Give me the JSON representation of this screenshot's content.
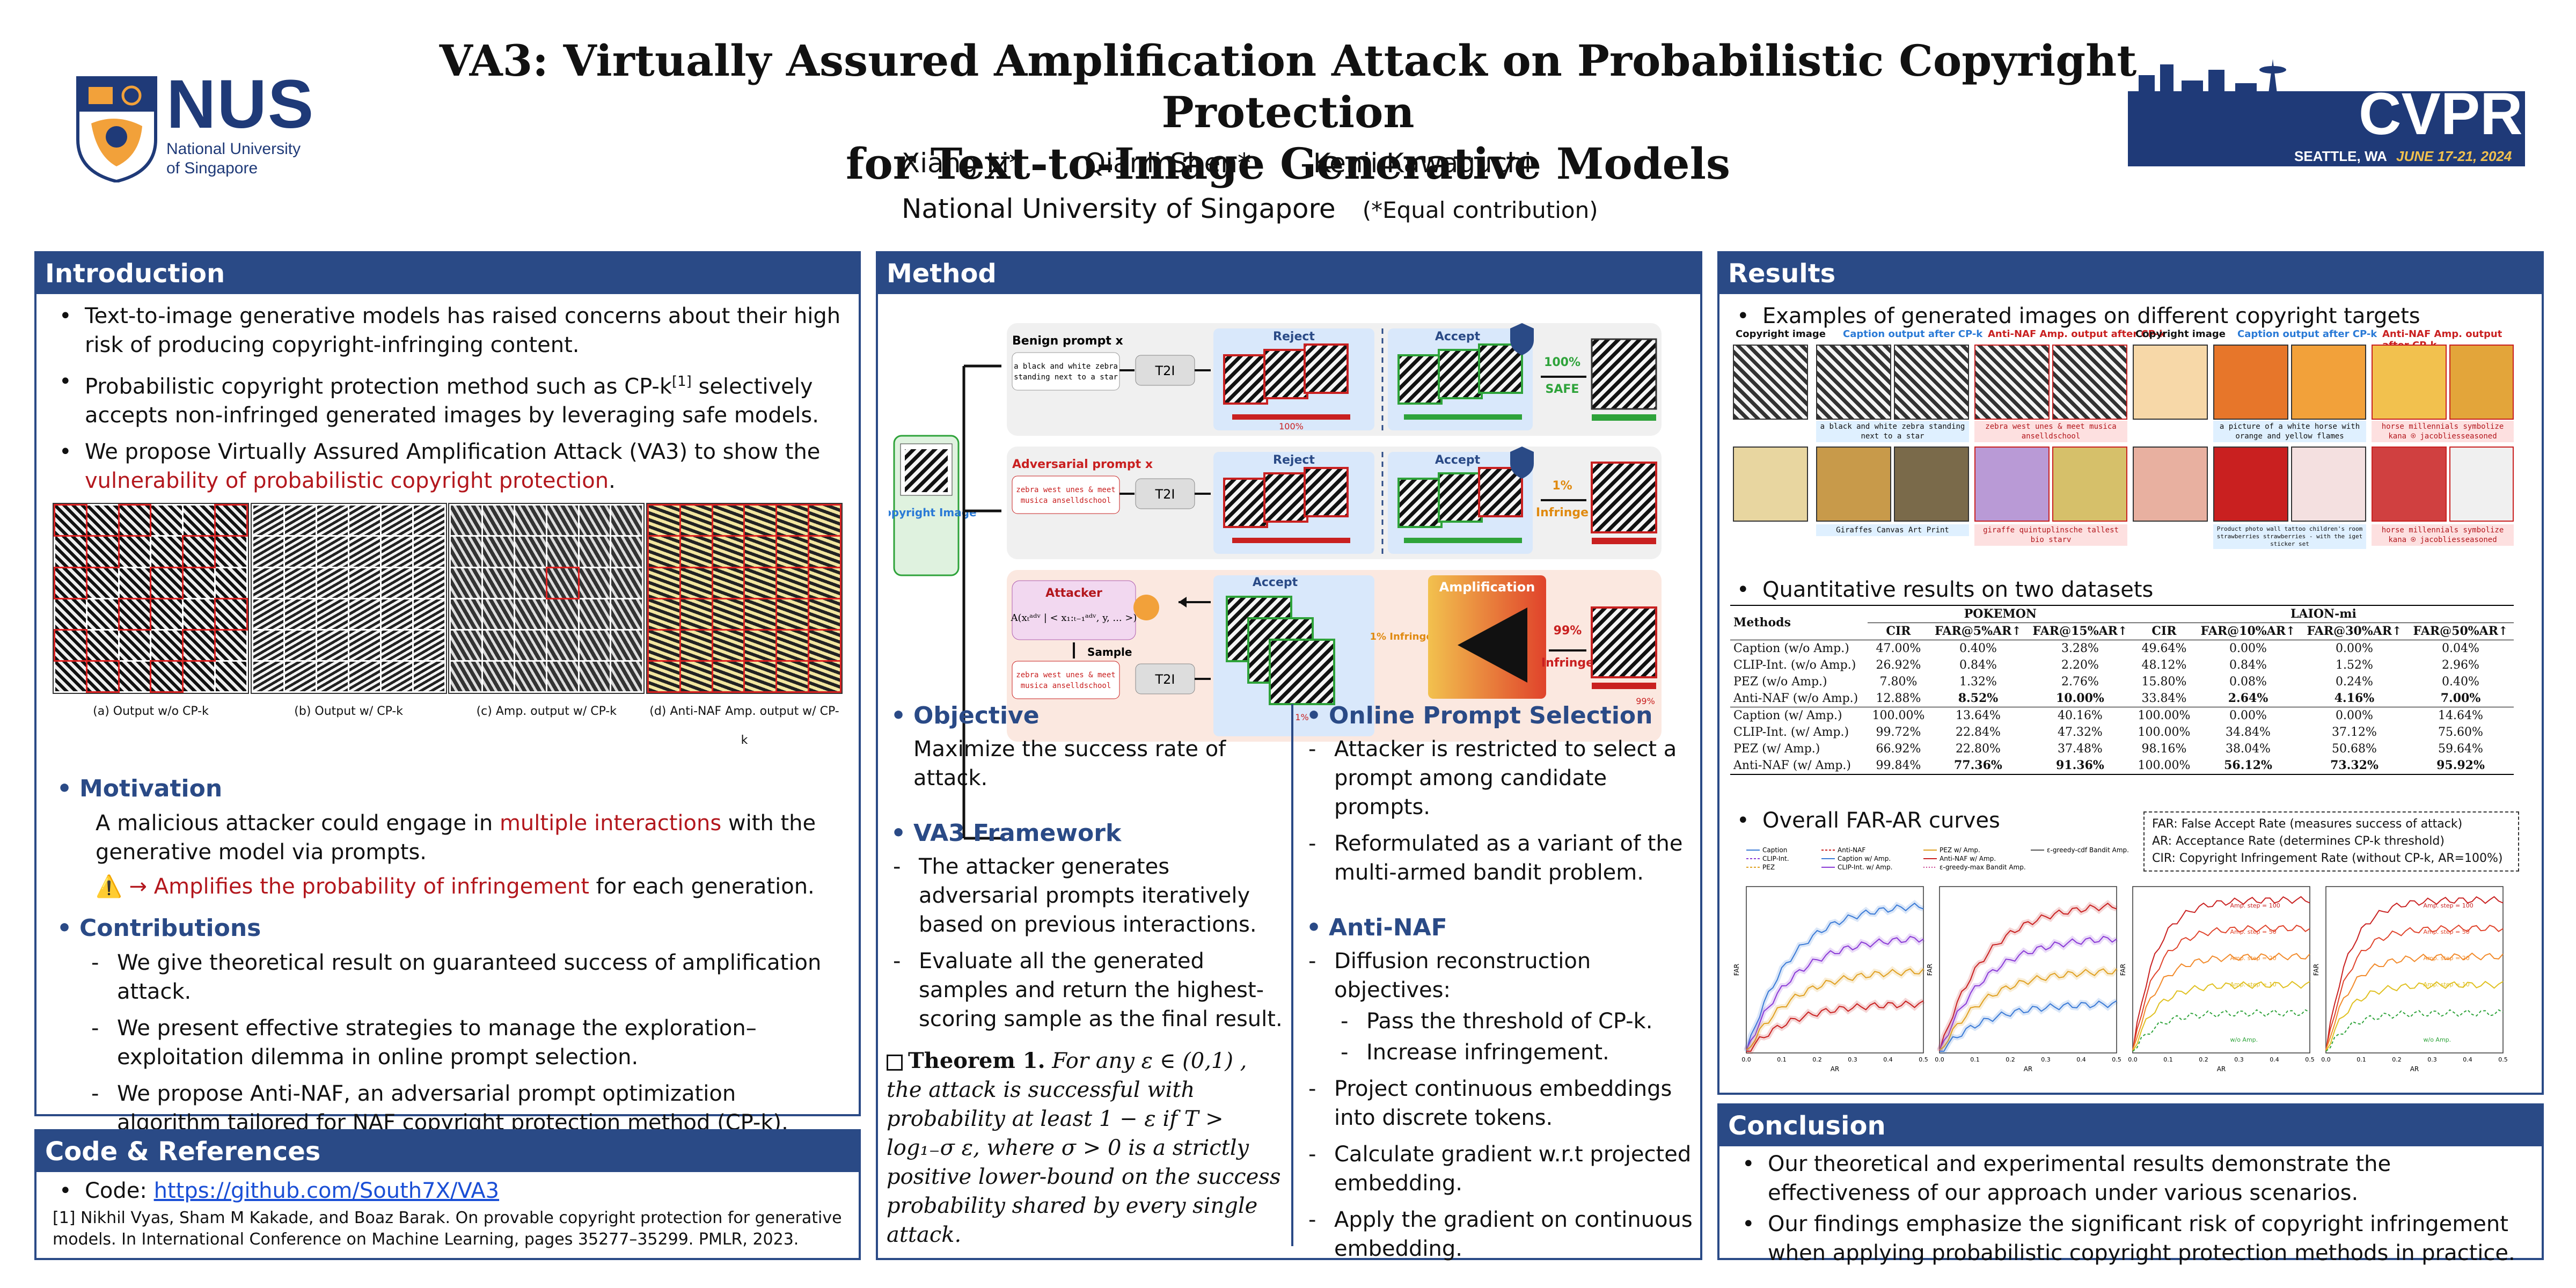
{
  "header": {
    "title_line1": "VA3: Virtually Assured Amplification Attack on Probabilistic Copyright Protection",
    "title_line2": "for Text-to-Image Generative Models",
    "authors": [
      "Xiang Li*",
      "Qianli Shen*",
      "Kenji Kawaguchi"
    ],
    "affiliation": "National University of Singapore",
    "note": "(*Equal contribution)",
    "nus_big": "NUS",
    "nus_line1": "National University",
    "nus_line2": "of Singapore",
    "cvpr_title": "CVPR",
    "cvpr_location": "SEATTLE, WA",
    "cvpr_dates": "JUNE 17-21, 2024"
  },
  "intro": {
    "heading": "Introduction",
    "b1": "Text-to-image generative models has raised concerns about their high risk of producing copyright-infringing content.",
    "b2a": "Probabilistic copyright protection method such as CP-k",
    "b2sup": "[1]",
    "b2b": " selectively accepts non-infringed generated images by leveraging safe models.",
    "b3a": "We propose Virtually Assured Amplification Attack (VA3) to show the ",
    "b3red": "vulnerability of probabilistic copyright protection",
    "b3b": ".",
    "captions": [
      "(a) Output w/o CP-k",
      "(b) Output w/ CP-k",
      "(c) Amp. output w/ CP-k",
      "(d) Anti-NAF Amp. output w/ CP-k"
    ],
    "motivation_title": "Motivation",
    "motivation_a": "A malicious attacker could engage in ",
    "motivation_red": "multiple interactions",
    "motivation_b": " with the generative model via prompts.",
    "warning_icon": "⚠️",
    "warn_red": "→ Amplifies the probability of infringement",
    "warn_b": " for each generation.",
    "contrib_title": "Contributions",
    "contribs": [
      "We give theoretical result on guaranteed success of  amplification attack.",
      "We present effective strategies to manage the exploration–exploitation dilemma in online prompt selection.",
      "We propose Anti-NAF, an adversarial prompt optimization algorithm tailored for NAF copyright protection method (CP-k)."
    ]
  },
  "code": {
    "heading": "Code & References",
    "code_label": "Code: ",
    "code_link": "https://github.com/South7X/VA3",
    "ref": "[1] Nikhil Vyas, Sham M Kakade, and Boaz Barak. On provable copyright protection for generative models. In International Conference on Machine Learning, pages 35277–35299. PMLR, 2023."
  },
  "method": {
    "heading": "Method",
    "diagram": {
      "benign_label": "Benign prompt x",
      "benign_text": "a black and white zebra standing next to a star",
      "adv_label": "Adversarial prompt x",
      "adv_text": "zebra west unes & meet musica anselldschool",
      "t2i": "T2I",
      "reject": "Reject",
      "accept": "Accept",
      "safe_pct": "100%",
      "safe": "SAFE",
      "inf_pct": "1%",
      "infringe": "Infringe",
      "inf_pct2": "99%",
      "attacker": "Attacker",
      "sample": "Sample",
      "amplification": "Amplification",
      "copyright_image": "Copyright Image",
      "pct_100": "100%",
      "pct_99": "99%",
      "pct_1": "1%",
      "pct_1_infringe": "1% Infringe"
    },
    "objective_title": "Objective",
    "objective": "Maximize the success rate of attack.",
    "va3_title": "VA3 Framework",
    "va3_items": [
      "The attacker generates adversarial prompts iteratively based on previous interactions.",
      "Evaluate all the generated samples and return the highest-scoring sample as the final result."
    ],
    "theorem_label": "Theorem 1.",
    "theorem_text": "For any ε ∈ (0,1) , the attack is successful with probability at least 1 − ε if T > log₁₋σ ε, where σ > 0 is a strictly positive lower-bound on the success probability shared by every single attack.",
    "ops_title": "Online Prompt Selection",
    "ops_items": [
      "Attacker is restricted to select a prompt among candidate prompts.",
      "Reformulated as a variant of the multi-armed bandit problem."
    ],
    "naf_title": "Anti-NAF",
    "naf_item1": "Diffusion reconstruction objectives:",
    "naf_sub": [
      "Pass the threshold of CP-k.",
      "Increase infringement."
    ],
    "naf_items": [
      "Project continuous embeddings into discrete tokens.",
      "Calculate gradient w.r.t projected embedding.",
      "Apply the gradient on continuous embedding."
    ]
  },
  "results": {
    "heading": "Results",
    "examples_title": "Examples of generated images on different copyright targets",
    "col_heads": [
      "Copyright image",
      "Caption output after CP-k",
      "Anti-NAF Amp. output after CP-k",
      "Copyright image",
      "Caption output after CP-k",
      "Anti-NAF Amp. output after CP-k"
    ],
    "caps": [
      "a black and white zebra standing next to a star",
      "zebra west unes & meet musica anselldschool",
      "a picture of a white horse with orange and yellow flames",
      "horse millennials symbolize kana ⍟ jacobliesseasoned",
      "Giraffes Canvas Art Print",
      "giraffe quintuplinsche tallest bio starv",
      "Product photo wall tattoo children's room strawberries strawberries - with the iget sticker set",
      "horse millennials symbolize kana ⍟ jacobliesseasoned"
    ],
    "quant_title": "Quantitative results on two datasets",
    "table": {
      "methods_head": "Methods",
      "ds1": "POKEMON",
      "ds2": "LAION-mi",
      "cols1": [
        "CIR",
        "FAR@5%AR↑",
        "FAR@15%AR↑"
      ],
      "cols2": [
        "CIR",
        "FAR@10%AR↑",
        "FAR@30%AR↑",
        "FAR@50%AR↑"
      ],
      "rows": [
        [
          "Caption (w/o Amp.)",
          "47.00%",
          "0.40%",
          "3.28%",
          "49.64%",
          "0.00%",
          "0.00%",
          "0.04%"
        ],
        [
          "CLIP-Int. (w/o Amp.)",
          "26.92%",
          "0.84%",
          "2.20%",
          "48.12%",
          "0.84%",
          "1.52%",
          "2.96%"
        ],
        [
          "PEZ (w/o Amp.)",
          "7.80%",
          "1.32%",
          "2.76%",
          "15.80%",
          "0.08%",
          "0.24%",
          "0.40%"
        ],
        [
          "Anti-NAF (w/o Amp.)",
          "12.88%",
          "8.52%",
          "10.00%",
          "33.84%",
          "2.64%",
          "4.16%",
          "7.00%"
        ],
        [
          "Caption (w/ Amp.)",
          "100.00%",
          "13.64%",
          "40.16%",
          "100.00%",
          "0.00%",
          "0.00%",
          "14.64%"
        ],
        [
          "CLIP-Int. (w/ Amp.)",
          "99.72%",
          "22.84%",
          "47.32%",
          "100.00%",
          "34.84%",
          "37.12%",
          "75.60%"
        ],
        [
          "PEZ (w/ Amp.)",
          "66.92%",
          "22.80%",
          "37.48%",
          "98.16%",
          "38.04%",
          "50.68%",
          "59.64%"
        ],
        [
          "Anti-NAF (w/ Amp.)",
          "99.84%",
          "77.36%",
          "91.36%",
          "100.00%",
          "56.12%",
          "73.32%",
          "95.92%"
        ]
      ]
    },
    "curves_title": "Overall FAR-AR curves",
    "legend_notes": [
      "FAR: False Accept Rate (measures success of attack)",
      "AR: Acceptance Rate (determines CP-k threshold)",
      "CIR: Copyright Infringement Rate (without CP-k, AR=100%)"
    ],
    "plot_legend": [
      "Caption",
      "CLIP-Int.",
      "PEZ",
      "Anti-NAF",
      "Caption w/ Amp.",
      "CLIP-Int. w/ Amp.",
      "PEZ w/ Amp.",
      "Anti-NAF w/ Amp.",
      "ε-greedy-max Bandit Amp.",
      "ε-greedy-cdf Bandit Amp."
    ],
    "xlabel": "AR",
    "ylabel": "FAR",
    "amp_labels": [
      "Amp. step = 100",
      "Amp. step = 50",
      "Amp. step = 20",
      "Amp. step = 10",
      "w/o Amp."
    ],
    "ticks": [
      "0.0",
      "0.1",
      "0.2",
      "0.3",
      "0.4",
      "0.5"
    ]
  },
  "conclusion": {
    "heading": "Conclusion",
    "items": [
      "Our theoretical and experimental results demonstrate the effectiveness of our approach under various scenarios.",
      "Our findings emphasize the significant risk of copyright infringement when applying probabilistic copyright protection methods in practice."
    ]
  },
  "colors": {
    "panel": "#2a4a86",
    "accent_red": "#b3171d",
    "accept_green": "#2ea33a"
  }
}
